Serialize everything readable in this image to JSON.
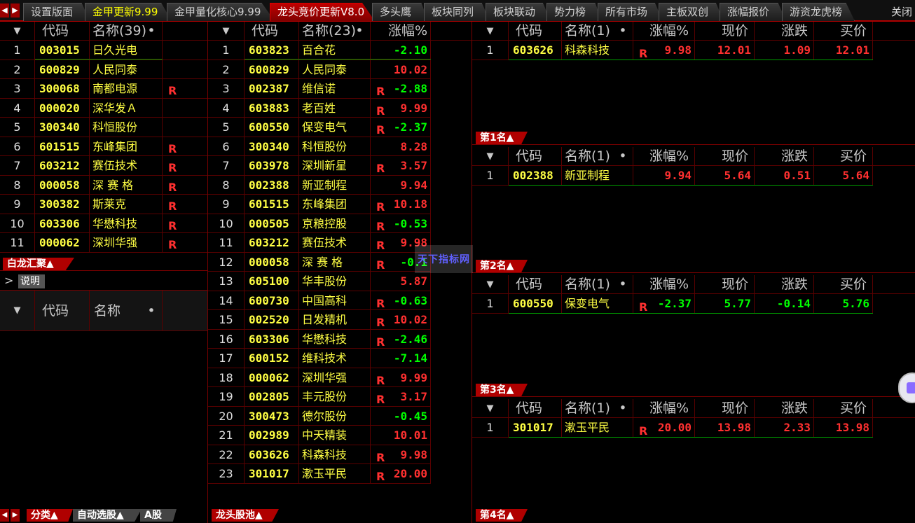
{
  "tabs": [
    {
      "label": "设置版面",
      "style": "normal"
    },
    {
      "label": "金甲更新9.99",
      "style": "yellow"
    },
    {
      "label": "金甲量化核心9.99",
      "style": "normal"
    },
    {
      "label": "龙头竞价更新V8.0",
      "style": "active"
    },
    {
      "label": "多头鹰",
      "style": "normal"
    },
    {
      "label": "板块同列",
      "style": "normal"
    },
    {
      "label": "板块联动",
      "style": "normal"
    },
    {
      "label": "势力榜",
      "style": "normal"
    },
    {
      "label": "所有市场",
      "style": "normal"
    },
    {
      "label": "主板双创",
      "style": "normal"
    },
    {
      "label": "涨幅报价",
      "style": "normal"
    },
    {
      "label": "游资龙虎榜",
      "style": "normal"
    }
  ],
  "close_label": "关闭",
  "left_panel": {
    "headers": {
      "sort": "▼",
      "code": "代码",
      "name": "名称(39)",
      "dot": "•"
    },
    "rows": [
      {
        "i": "1",
        "code": "003015",
        "name": "日久光电",
        "r": ""
      },
      {
        "i": "2",
        "code": "600829",
        "name": "人民同泰",
        "r": ""
      },
      {
        "i": "3",
        "code": "300068",
        "name": "南都电源",
        "r": "R"
      },
      {
        "i": "4",
        "code": "000020",
        "name": "深华发Ａ",
        "r": ""
      },
      {
        "i": "5",
        "code": "300340",
        "name": "科恒股份",
        "r": ""
      },
      {
        "i": "6",
        "code": "601515",
        "name": "东峰集团",
        "r": "R"
      },
      {
        "i": "7",
        "code": "603212",
        "name": "赛伍技术",
        "r": "R"
      },
      {
        "i": "8",
        "code": "000058",
        "name": "深 赛 格",
        "r": "R"
      },
      {
        "i": "9",
        "code": "300382",
        "name": "斯莱克",
        "r": "R"
      },
      {
        "i": "10",
        "code": "603306",
        "name": "华懋科技",
        "r": "R"
      },
      {
        "i": "11",
        "code": "000062",
        "name": "深圳华强",
        "r": "R"
      }
    ],
    "section_label": "白龙汇聚▲",
    "explain_label": "说明",
    "sub_headers": {
      "sort": "▼",
      "code": "代码",
      "name": "名称",
      "dot": "•"
    },
    "bottom_tabs": [
      "分类▲",
      "自动选股▲",
      "A股"
    ]
  },
  "middle_panel": {
    "headers": {
      "sort": "▼",
      "code": "代码",
      "name": "名称(23)",
      "dot": "•",
      "change": "涨幅%"
    },
    "rows": [
      {
        "i": "1",
        "code": "603823",
        "name": "百合花",
        "r": "",
        "chg": "-2.10"
      },
      {
        "i": "2",
        "code": "600829",
        "name": "人民同泰",
        "r": "",
        "chg": "10.02"
      },
      {
        "i": "3",
        "code": "002387",
        "name": "维信诺",
        "r": "R",
        "chg": "-2.88"
      },
      {
        "i": "4",
        "code": "603883",
        "name": "老百姓",
        "r": "R",
        "chg": "9.99"
      },
      {
        "i": "5",
        "code": "600550",
        "name": "保变电气",
        "r": "R",
        "chg": "-2.37"
      },
      {
        "i": "6",
        "code": "300340",
        "name": "科恒股份",
        "r": "",
        "chg": "8.28"
      },
      {
        "i": "7",
        "code": "603978",
        "name": "深圳新星",
        "r": "R",
        "chg": "3.57"
      },
      {
        "i": "8",
        "code": "002388",
        "name": "新亚制程",
        "r": "",
        "chg": "9.94"
      },
      {
        "i": "9",
        "code": "601515",
        "name": "东峰集团",
        "r": "R",
        "chg": "10.18"
      },
      {
        "i": "10",
        "code": "000505",
        "name": "京粮控股",
        "r": "R",
        "chg": "-0.53"
      },
      {
        "i": "11",
        "code": "603212",
        "name": "赛伍技术",
        "r": "R",
        "chg": "9.98"
      },
      {
        "i": "12",
        "code": "000058",
        "name": "深 赛 格",
        "r": "R",
        "chg": "-0.1"
      },
      {
        "i": "13",
        "code": "605100",
        "name": "华丰股份",
        "r": "",
        "chg": "5.87"
      },
      {
        "i": "14",
        "code": "600730",
        "name": "中国高科",
        "r": "R",
        "chg": "-0.63"
      },
      {
        "i": "15",
        "code": "002520",
        "name": "日发精机",
        "r": "R",
        "chg": "10.02"
      },
      {
        "i": "16",
        "code": "603306",
        "name": "华懋科技",
        "r": "R",
        "chg": "-2.46"
      },
      {
        "i": "17",
        "code": "600152",
        "name": "维科技术",
        "r": "",
        "chg": "-7.14"
      },
      {
        "i": "18",
        "code": "000062",
        "name": "深圳华强",
        "r": "R",
        "chg": "9.99"
      },
      {
        "i": "19",
        "code": "002805",
        "name": "丰元股份",
        "r": "R",
        "chg": "3.17"
      },
      {
        "i": "20",
        "code": "300473",
        "name": "德尔股份",
        "r": "",
        "chg": "-0.45"
      },
      {
        "i": "21",
        "code": "002989",
        "name": "中天精装",
        "r": "",
        "chg": "10.01"
      },
      {
        "i": "22",
        "code": "603626",
        "name": "科森科技",
        "r": "R",
        "chg": "9.98"
      },
      {
        "i": "23",
        "code": "301017",
        "name": "漱玉平民",
        "r": "R",
        "chg": "20.00"
      }
    ],
    "bottom_tab": "龙头股池▲"
  },
  "right_panel": {
    "headers": {
      "sort": "▼",
      "code": "代码",
      "name": "名称(1)",
      "dot": "•",
      "change": "涨幅%",
      "price": "现价",
      "delta": "涨跌",
      "bid": "买价"
    },
    "blocks": [
      {
        "row": {
          "i": "1",
          "code": "603626",
          "name": "科森科技",
          "r": "R",
          "chg": "9.98",
          "price": "12.01",
          "delta": "1.09",
          "bid": "12.01"
        },
        "label": "第1名▲"
      },
      {
        "row": {
          "i": "1",
          "code": "002388",
          "name": "新亚制程",
          "r": "",
          "chg": "9.94",
          "price": "5.64",
          "delta": "0.51",
          "bid": "5.64"
        },
        "label": "第2名▲"
      },
      {
        "row": {
          "i": "1",
          "code": "600550",
          "name": "保变电气",
          "r": "R",
          "chg": "-2.37",
          "price": "5.77",
          "delta": "-0.14",
          "bid": "5.76"
        },
        "label": "第3名▲"
      },
      {
        "row": {
          "i": "1",
          "code": "301017",
          "name": "漱玉平民",
          "r": "R",
          "chg": "20.00",
          "price": "13.98",
          "delta": "2.33",
          "bid": "13.98"
        },
        "label": "第4名▲"
      }
    ]
  },
  "watermark": "天下指标网",
  "colors": {
    "up": "#ff3030",
    "down": "#00ff00",
    "code": "#ffff44",
    "border": "#5a0000"
  }
}
